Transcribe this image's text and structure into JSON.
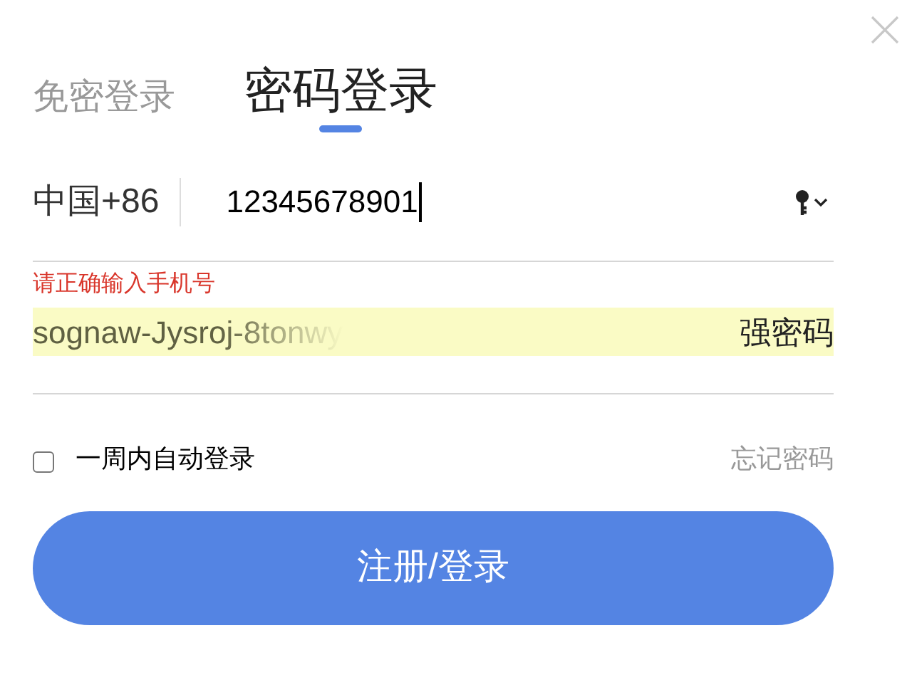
{
  "tabs": [
    {
      "label": "免密登录",
      "selected": false
    },
    {
      "label": "密码登录",
      "selected": true
    }
  ],
  "phone": {
    "country_code": "中国+86",
    "value": "12345678901"
  },
  "error": "请正确输入手机号",
  "password": {
    "value": "sognaw-Jysroj-8tonwy",
    "autofilled": true,
    "strength": "强密码"
  },
  "remember": {
    "label": "一周内自动登录",
    "checked": false
  },
  "forgot_link": "忘记密码",
  "submit": "注册/登录"
}
